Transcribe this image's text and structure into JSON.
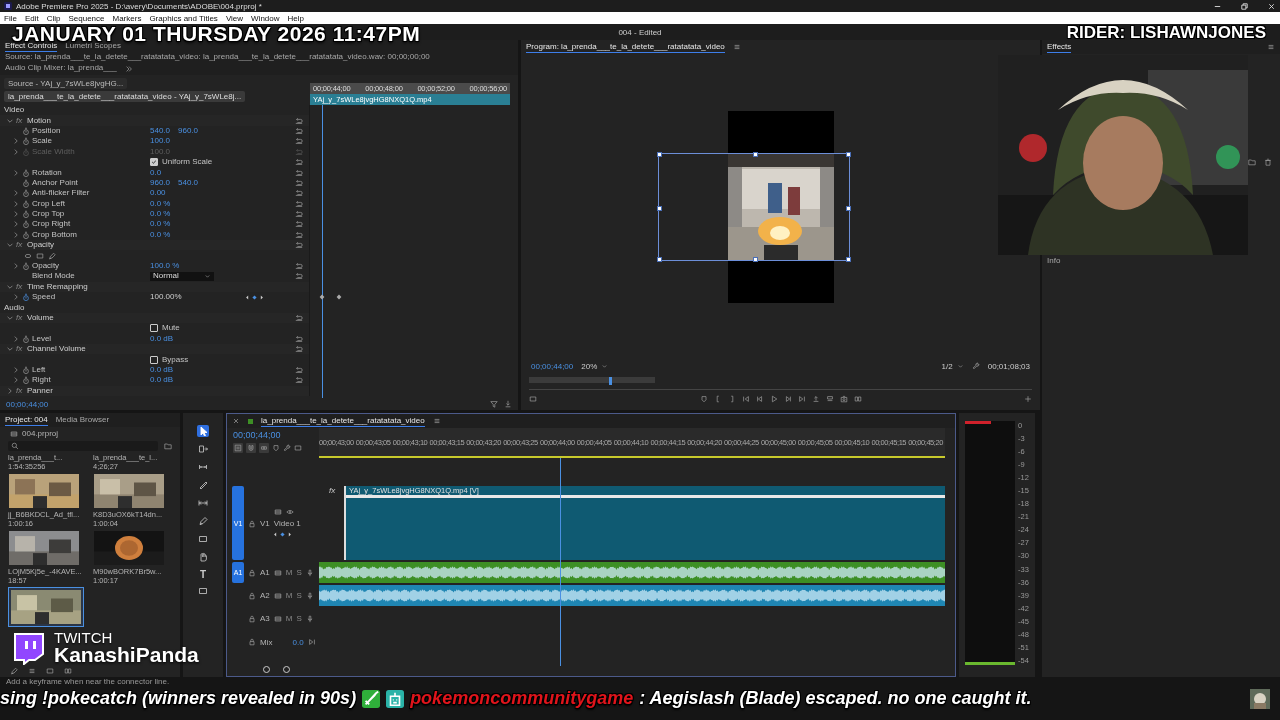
{
  "title_bar": {
    "title": "Adobe Premiere Pro 2025 - D:\\avery\\Documents\\ADOBE\\004.prproj *"
  },
  "menu": [
    "File",
    "Edit",
    "Clip",
    "Sequence",
    "Markers",
    "Graphics and Titles",
    "View",
    "Window",
    "Help"
  ],
  "document_status": "004 - Edited",
  "stream_overlay": {
    "clock": "JANUARY 01 THURSDAY 2026 11:47PM",
    "rider": "RIDER: LISHAWNJONES",
    "twitch_label": "TWITCH",
    "twitch_name": "KanashiPanda",
    "ticker_lead": "sing !pokecatch (winners revealed in 90s)",
    "ticker_user": "pokemoncommunitygame",
    "ticker_message": ": Aegislash (Blade) escaped. no one caught it."
  },
  "panel_tabs": [
    {
      "label": "Effect Controls",
      "selected": true
    },
    {
      "label": "Lumetri Scopes",
      "selected": false
    },
    {
      "label": "Source: la_prenda___te_la_detete___ratatatata_video: la_prenda___te_la_detete___ratatatata_video.wav: 00;00;00;00",
      "selected": false
    },
    {
      "label": "Audio Clip Mixer: la_prenda___",
      "selected": false
    }
  ],
  "effect_controls": {
    "source_tab": "Source - YAj_y_7sWLe8jvgHG...",
    "sequence_tab": "la_prenda___te_la_detete___ratatatata_video - YAj_y_7sWLe8j...",
    "ruler": [
      "00;00;44;00",
      "00;00;48;00",
      "00;00;52;00",
      "00;00;56;00"
    ],
    "clip": "YAj_y_7sWLe8jvgHG8NXQ1Q.mp4",
    "timecode": "00;00;44;00",
    "rows": [
      {
        "kind": "section",
        "label": "Video"
      },
      {
        "kind": "group",
        "badge": "fx",
        "label": "Motion",
        "expanded": true,
        "reset": true
      },
      {
        "kind": "param",
        "label": "Position",
        "values": [
          "540.0",
          "960.0"
        ],
        "expandable": false,
        "disabled": false,
        "reset": true,
        "keyframe_nav": false
      },
      {
        "kind": "param",
        "label": "Scale",
        "values": [
          "100.0"
        ],
        "expandable": true,
        "disabled": false,
        "reset": true,
        "keyframe_nav": false
      },
      {
        "kind": "param",
        "label": "Scale Width",
        "values": [
          "100.0"
        ],
        "expandable": true,
        "disabled": true,
        "reset": true,
        "keyframe_nav": false
      },
      {
        "kind": "checkbox",
        "label": "Uniform Scale",
        "checked": true,
        "reset": true
      },
      {
        "kind": "param",
        "label": "Rotation",
        "values": [
          "0.0"
        ],
        "expandable": true,
        "disabled": false,
        "reset": true,
        "keyframe_nav": false
      },
      {
        "kind": "param",
        "label": "Anchor Point",
        "values": [
          "960.0",
          "540.0"
        ],
        "expandable": false,
        "disabled": false,
        "reset": true,
        "keyframe_nav": false
      },
      {
        "kind": "param",
        "label": "Anti-flicker Filter",
        "values": [
          "0.00"
        ],
        "expandable": true,
        "disabled": false,
        "reset": true,
        "keyframe_nav": false
      },
      {
        "kind": "param",
        "label": "Crop Left",
        "values": [
          "0.0 %"
        ],
        "expandable": true,
        "disabled": false,
        "reset": true,
        "keyframe_nav": false
      },
      {
        "kind": "param",
        "label": "Crop Top",
        "values": [
          "0.0 %"
        ],
        "expandable": true,
        "disabled": false,
        "reset": true,
        "keyframe_nav": false
      },
      {
        "kind": "param",
        "label": "Crop Right",
        "values": [
          "0.0 %"
        ],
        "expandable": true,
        "disabled": false,
        "reset": true,
        "keyframe_nav": false
      },
      {
        "kind": "param",
        "label": "Crop Bottom",
        "values": [
          "0.0 %"
        ],
        "expandable": true,
        "disabled": false,
        "reset": true,
        "keyframe_nav": false
      },
      {
        "kind": "group",
        "badge": "fx",
        "label": "Opacity",
        "expanded": true,
        "reset": true
      },
      {
        "kind": "mask_tools"
      },
      {
        "kind": "param",
        "label": "Opacity",
        "values": [
          "100.0 %"
        ],
        "expandable": true,
        "disabled": false,
        "reset": true,
        "keyframe_nav": false
      },
      {
        "kind": "dropdown",
        "label": "Blend Mode",
        "value": "Normal",
        "reset": true
      },
      {
        "kind": "group",
        "badge": "fx",
        "label": "Time Remapping",
        "expanded": true,
        "reset": false
      },
      {
        "kind": "param",
        "label": "Speed",
        "values": [
          "100.00%"
        ],
        "expandable": true,
        "disabled": false,
        "reset": false,
        "keyframe_nav": true
      },
      {
        "kind": "section",
        "label": "Audio"
      },
      {
        "kind": "group",
        "badge": "fx",
        "label": "Volume",
        "expanded": true,
        "reset": true
      },
      {
        "kind": "checkbox",
        "label": "Mute",
        "checked": false,
        "reset": false
      },
      {
        "kind": "param",
        "label": "Level",
        "values": [
          "0.0 dB"
        ],
        "expandable": true,
        "disabled": false,
        "reset": true,
        "keyframe_nav": false
      },
      {
        "kind": "group",
        "badge": "fx",
        "label": "Channel Volume",
        "expanded": true,
        "reset": true
      },
      {
        "kind": "checkbox",
        "label": "Bypass",
        "checked": false,
        "reset": false
      },
      {
        "kind": "param",
        "label": "Left",
        "values": [
          "0.0 dB"
        ],
        "expandable": true,
        "disabled": false,
        "reset": true,
        "keyframe_nav": false
      },
      {
        "kind": "param",
        "label": "Right",
        "values": [
          "0.0 dB"
        ],
        "expandable": true,
        "disabled": false,
        "reset": true,
        "keyframe_nav": false
      },
      {
        "kind": "group",
        "badge": "fx",
        "label": "Panner",
        "expanded": false,
        "reset": false
      }
    ]
  },
  "program": {
    "title": "Program: la_prenda___te_la_detete___ratatatata_video",
    "timecode": "00;00;44;00",
    "zoom": "20%",
    "quality": "1/2",
    "duration": "00;01;08;03"
  },
  "right_panel": {
    "effects_title": "Effects",
    "info_title": "Info"
  },
  "project": {
    "tabs": [
      {
        "label": "Project: 004",
        "selected": true
      },
      {
        "label": "Media Browser",
        "selected": false
      }
    ],
    "file": "004.prproj",
    "items": [
      {
        "kind": "name_only",
        "name": "la_prenda___t...",
        "duration": "1:54:35256",
        "selected": false
      },
      {
        "kind": "name_only",
        "name": "la_prenda___te_l...",
        "duration": "4;26;27",
        "selected": false
      },
      {
        "kind": "clip",
        "name": "jj_B6BKDCL_Ad_tfl...",
        "duration": "1:00:16",
        "selected": false
      },
      {
        "kind": "clip",
        "name": "K8D3uOX6kT14dn...",
        "duration": "1:00:04",
        "selected": false
      },
      {
        "kind": "clip",
        "name": "LOjM5Kj5e_-4KAVE...",
        "duration": "18:57",
        "selected": false
      },
      {
        "kind": "clip",
        "name": "M90wBORK7Br5w...",
        "duration": "1:00:17",
        "selected": false
      },
      {
        "kind": "clip",
        "selected": true
      }
    ]
  },
  "tools": {
    "type_glyph": "T"
  },
  "timeline": {
    "fx_badge": "fx",
    "tab": "la_prenda___te_la_detete___ratatatata_video",
    "timecode": "00;00;44;00",
    "ruler": [
      "00;00;43;00",
      "00;00;43;05",
      "00;00;43;10",
      "00;00;43;15",
      "00;00;43;20",
      "00;00;43;25",
      "00;00;44;00",
      "00;00;44;05",
      "00;00;44;10",
      "00;00;44;15",
      "00;00;44;20",
      "00;00;44;25",
      "00;00;45;00",
      "00;00;45;05",
      "00;00;45;10",
      "00;00;45;15",
      "00;00;45;20"
    ],
    "tracks": [
      {
        "kind": "video",
        "target": "V1",
        "name": "V1",
        "label": "Video 1",
        "targeted": true,
        "clip": "YAj_y_7sWLe8jvgHG8NXQ1Q.mp4 [V]"
      },
      {
        "kind": "audio",
        "target": "A1",
        "name": "A1",
        "targeted": true,
        "mute": "M",
        "solo": "S",
        "color": "#3d8f25"
      },
      {
        "kind": "audio",
        "name": "A2",
        "targeted": false,
        "mute": "M",
        "solo": "S",
        "color": "#1f86b3"
      },
      {
        "kind": "audio",
        "name": "A3",
        "targeted": false,
        "mute": "M",
        "solo": "S"
      },
      {
        "kind": "mix",
        "name": "Mix",
        "value": "0.0"
      }
    ]
  },
  "meter": {
    "scale": [
      "0",
      "-3",
      "-6",
      "-9",
      "-12",
      "-15",
      "-18",
      "-21",
      "-24",
      "-27",
      "-30",
      "-33",
      "-36",
      "-39",
      "-42",
      "-45",
      "-48",
      "-51",
      "-54"
    ]
  },
  "status_bar": "Add a keyframe when near the connector line."
}
